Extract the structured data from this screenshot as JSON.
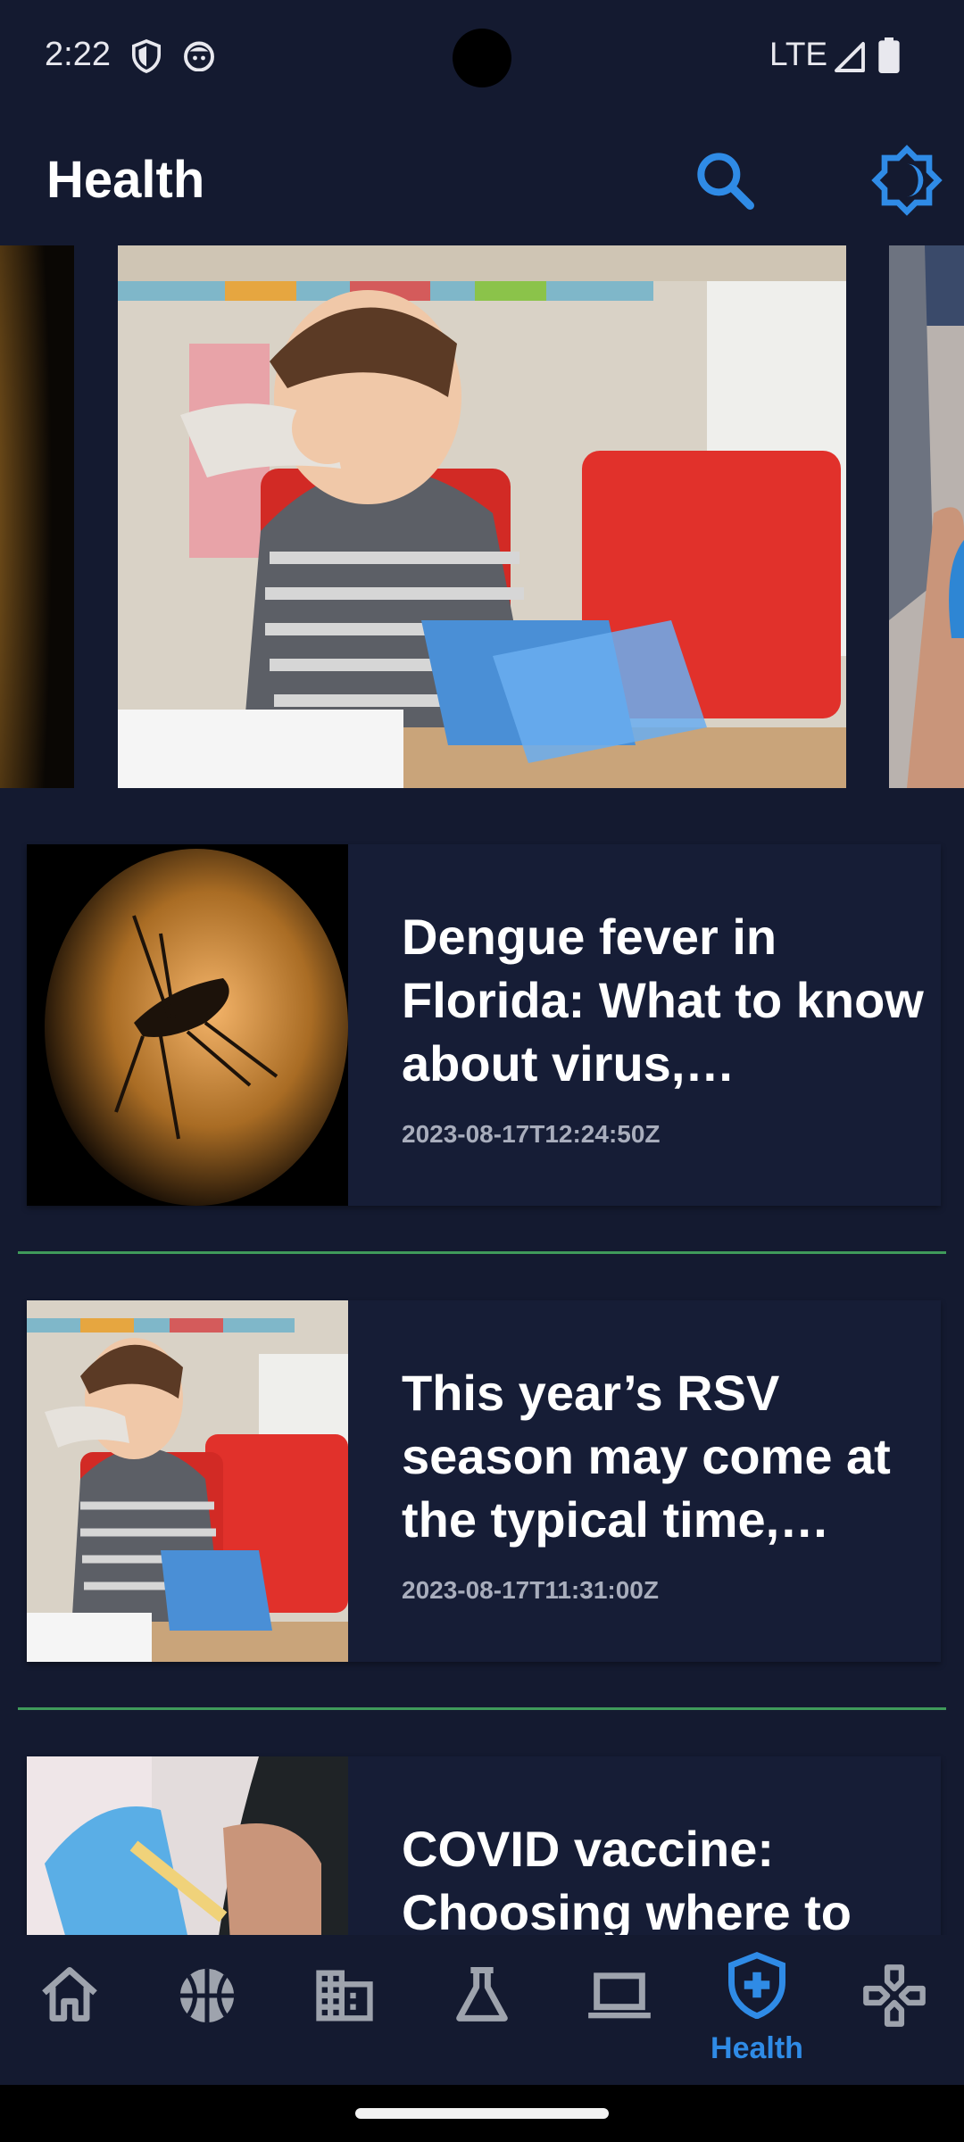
{
  "status_bar": {
    "time": "2:22",
    "network": "LTE",
    "icons": [
      "shield-icon",
      "cat-face-icon",
      "signal-icon",
      "battery-icon"
    ]
  },
  "app_bar": {
    "title": "Health",
    "actions": [
      "search-icon",
      "brightness-icon"
    ]
  },
  "carousel": {
    "slides": [
      {
        "image": "mosquito-photo"
      },
      {
        "image": "child-sneezing-photo"
      },
      {
        "image": "vaccine-photo"
      }
    ]
  },
  "articles": [
    {
      "title": "Dengue fever in Florida: What to know about virus, symptoms and more",
      "date": "2023-08-17T12:24:50Z",
      "image": "mosquito-photo"
    },
    {
      "title": "This year’s RSV season may come at the typical time, experts say",
      "date": "2023-08-17T11:31:00Z",
      "image": "child-sneezing-photo"
    },
    {
      "title": "COVID vaccine: Choosing where to get your shot",
      "date": "",
      "image": "vaccine-photo"
    }
  ],
  "bottom_nav": {
    "items": [
      {
        "icon": "home-icon",
        "label": ""
      },
      {
        "icon": "basketball-icon",
        "label": ""
      },
      {
        "icon": "business-building-icon",
        "label": ""
      },
      {
        "icon": "science-flask-icon",
        "label": ""
      },
      {
        "icon": "laptop-icon",
        "label": ""
      },
      {
        "icon": "health-shield-icon",
        "label": "Health"
      },
      {
        "icon": "gamepad-icon",
        "label": ""
      }
    ],
    "active_index": 5
  },
  "colors": {
    "background": "#141a30",
    "card": "#161d36",
    "accent": "#2f8be6",
    "divider": "#3f9a5a",
    "date_text": "#a8adbc",
    "inactive_icon": "#9ea3ad"
  }
}
